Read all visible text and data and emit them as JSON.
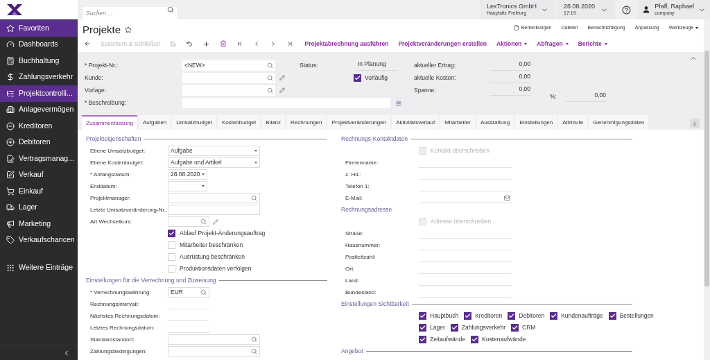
{
  "sidebar": {
    "items": [
      {
        "label": "Favoriten",
        "selected": true
      },
      {
        "label": "Dashboards",
        "selected": false
      },
      {
        "label": "Buchhaltung",
        "selected": false
      },
      {
        "label": "Zahlungsverkehr",
        "selected": false
      },
      {
        "label": "Projektcontrolli...",
        "selected": true
      },
      {
        "label": "Anlagevermögen",
        "selected": false
      },
      {
        "label": "Kreditoren",
        "selected": false
      },
      {
        "label": "Debitoren",
        "selected": false
      },
      {
        "label": "Vertragsmanag...",
        "selected": false
      },
      {
        "label": "Verkauf",
        "selected": false
      },
      {
        "label": "Einkauf",
        "selected": false
      },
      {
        "label": "Lager",
        "selected": false
      },
      {
        "label": "Marketing",
        "selected": false
      },
      {
        "label": "Verkaufschancen",
        "selected": false
      }
    ],
    "more": "Weitere Einträge"
  },
  "topbar": {
    "search": {
      "placeholder": "Suchen ..."
    },
    "company": {
      "name": "LexTronics GmbH",
      "branch": "Hauptsitz Freiburg"
    },
    "date": {
      "date": "28.08.2020",
      "time": "17:19"
    },
    "user": {
      "name": "Pfaff, Raphael",
      "role": "company"
    }
  },
  "page": {
    "title": "Projekte"
  },
  "header_links": [
    {
      "label": "Bemerkungen",
      "kind": "note"
    },
    {
      "label": "Dateien",
      "kind": "plain"
    },
    {
      "label": "Benachrichtigung",
      "kind": "plain"
    },
    {
      "label": "Anpassung",
      "kind": "plain"
    },
    {
      "label": "Werkzeuge",
      "kind": "menu"
    }
  ],
  "toolbar": {
    "save_close": {
      "label": "Speichern & Schließen",
      "disabled": true
    },
    "actions": [
      {
        "label": "Projektabrechnung ausführen",
        "dropdown": false
      },
      {
        "label": "Projektveränderungen erstellen",
        "dropdown": false
      },
      {
        "label": "Aktionen",
        "dropdown": true
      },
      {
        "label": "Abfragen",
        "dropdown": true
      },
      {
        "label": "Berichte",
        "dropdown": true
      }
    ]
  },
  "summary": {
    "fields": [
      {
        "label": "* Projekt-Nr.:",
        "value": "<NEW>",
        "kind": "lookup"
      },
      {
        "label": "Kunde:",
        "kind": "lookup_edit"
      },
      {
        "label": "Vorlage:",
        "kind": "lookup_edit"
      },
      {
        "label": "* Beschreibung:",
        "kind": "wide",
        "language": "de"
      }
    ],
    "status": {
      "label": "Status:",
      "value": "In Planung"
    },
    "preliminary": {
      "label": "Vorläufig",
      "checked": true
    },
    "totals": [
      {
        "label": "aktueller Ertrag:",
        "value": "0,00"
      },
      {
        "label": "aktuelle Kosten:",
        "value": "0,00"
      },
      {
        "label": "Spanne:",
        "value": "0,00"
      }
    ],
    "percent": {
      "label": "%:",
      "value": "0,00"
    }
  },
  "tabs": [
    {
      "label": "Zusammenfassung",
      "selected": true
    },
    {
      "label": "Aufgaben",
      "selected": false
    },
    {
      "label": "Umsatzbudget",
      "selected": false
    },
    {
      "label": "Kostenbudget",
      "selected": false
    },
    {
      "label": "Bilanz",
      "selected": false
    },
    {
      "label": "Rechnungen",
      "selected": false
    },
    {
      "label": "Projektveränderungen",
      "selected": false
    },
    {
      "label": "Aktivitätsverlauf",
      "selected": false
    },
    {
      "label": "Mitarbeiter",
      "selected": false
    },
    {
      "label": "Ausstattung",
      "selected": false
    },
    {
      "label": "Einstellungen",
      "selected": false
    },
    {
      "label": "Attribute",
      "selected": false
    },
    {
      "label": "Genehmigungsdaten",
      "selected": false
    }
  ],
  "left_sections": [
    {
      "title": "Projekteigenschaften",
      "rows": [
        {
          "kind": "select",
          "label": "Ebene Umsatzbudget:",
          "value": "Aufgabe"
        },
        {
          "kind": "select",
          "label": "Ebene Kostenbudget:",
          "value": "Aufgabe und Artikel"
        },
        {
          "kind": "date",
          "label": "* Anfangsdatum:",
          "value": "28.08.2020"
        },
        {
          "kind": "date",
          "label": "Enddatum:"
        },
        {
          "kind": "lookup",
          "label": "Projektmanager:"
        },
        {
          "kind": "text",
          "label": "Letzte Umsatzveränderung-Nr.:"
        },
        {
          "kind": "lookup_small_edit",
          "label": "Art Wechselkurs:"
        },
        {
          "kind": "check",
          "label": "Ablauf Projekt-Änderungsauftrag",
          "checked": true,
          "disabled": false
        },
        {
          "kind": "check",
          "label": "Mitarbeiter beschränken",
          "checked": false,
          "disabled": false
        },
        {
          "kind": "check",
          "label": "Ausrüstung beschränken",
          "checked": false,
          "disabled": false
        },
        {
          "kind": "check",
          "label": "Produktionsdaten verfolgen",
          "checked": false,
          "disabled": false
        }
      ]
    },
    {
      "title": "Einstellungen für die Verrechnung und Zuweisung",
      "rows": [
        {
          "kind": "lookup_small",
          "label": "* Verrechnungswährung:",
          "value": "EUR"
        },
        {
          "kind": "line",
          "label": "Rechnungsintervall:"
        },
        {
          "kind": "line",
          "label": "Nächstes Rechnungsdatum:"
        },
        {
          "kind": "line",
          "label": "Letztes Rechnungsdatum:"
        },
        {
          "kind": "lookup",
          "label": "Standardstandort:"
        },
        {
          "kind": "lookup",
          "label": "Zahlungsbedingungen:"
        }
      ]
    }
  ],
  "right_sections": [
    {
      "title": "Rechnungs-Kontaktdaten",
      "rows": [
        {
          "kind": "check",
          "label": "Kontakt überschreiben",
          "checked": false,
          "disabled": true
        },
        {
          "kind": "line",
          "label": "Firmenname:"
        },
        {
          "kind": "line",
          "label": "z. Hd.:"
        },
        {
          "kind": "line",
          "label": "Telefon 1:"
        },
        {
          "kind": "email",
          "label": "E-Mail:"
        },
        {
          "kind": "subheading",
          "label": "Rechnungsadresse"
        },
        {
          "kind": "check",
          "label": "Adresse überschreiben",
          "checked": false,
          "disabled": true
        },
        {
          "kind": "line",
          "label": "Straße:"
        },
        {
          "kind": "line",
          "label": "Hausnummer:"
        },
        {
          "kind": "line",
          "label": "Postleitzahl:"
        },
        {
          "kind": "line",
          "label": "Ort:"
        },
        {
          "kind": "line",
          "label": "Land:"
        },
        {
          "kind": "line",
          "label": "Bundesland:"
        }
      ]
    },
    {
      "title": "Einstellungen Sichtbarkeit",
      "checkgrid": [
        [
          {
            "label": "Hauptbuch",
            "checked": true
          },
          {
            "label": "Kreditoren",
            "checked": true
          },
          {
            "label": "Debitoren",
            "checked": true
          },
          {
            "label": "Kundenaufträge",
            "checked": true
          },
          {
            "label": "Bestellungen",
            "checked": true
          }
        ],
        [
          {
            "label": "Lager",
            "checked": true
          },
          {
            "label": "Zahlungsverkehr",
            "checked": true
          },
          {
            "label": "CRM",
            "checked": true
          }
        ],
        [
          {
            "label": "Zeitaufwände",
            "checked": true
          },
          {
            "label": "Kostenaufwände",
            "checked": true
          }
        ]
      ]
    },
    {
      "title": "Angebot"
    }
  ]
}
